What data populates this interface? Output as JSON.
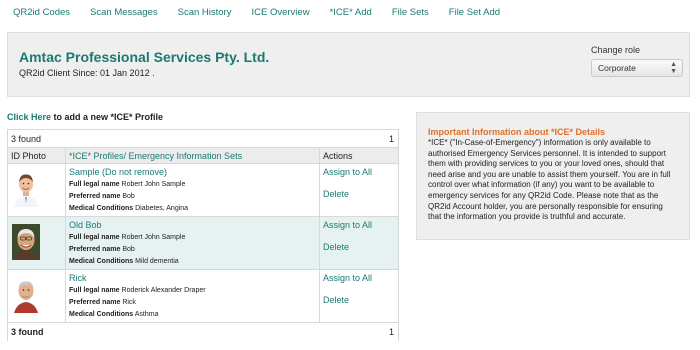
{
  "nav": {
    "items": [
      "QR2id Codes",
      "Scan Messages",
      "Scan History",
      "ICE Overview",
      "*ICE* Add",
      "File Sets",
      "File Set Add"
    ]
  },
  "header": {
    "company": "Amtac Professional Services Pty. Ltd.",
    "client_since": "QR2id Client Since: 01 Jan 2012 .",
    "role_label": "Change role",
    "role_value": "Corporate"
  },
  "add_profile": {
    "link": "Click Here",
    "text": " to add a new *ICE* Profile"
  },
  "table": {
    "count_top": "3 found",
    "page_top": "1",
    "columns": [
      "ID Photo",
      "*ICE* Profiles/ Emergency Information Sets",
      "Actions"
    ],
    "labels": {
      "legal": "Full legal name",
      "preferred": "Preferred name",
      "medical": "Medical Conditions"
    },
    "rows": [
      {
        "name": "Sample (Do not remove)",
        "legal": "Robert John Sample",
        "preferred": "Bob",
        "medical": "Diabetes, Angina",
        "assign": "Assign to All",
        "delete": "Delete"
      },
      {
        "name": "Old Bob",
        "legal": "Robert John Sample",
        "preferred": "Bob",
        "medical": "Mild dementia",
        "assign": "Assign to All",
        "delete": "Delete"
      },
      {
        "name": "Rick",
        "legal": "Roderick Alexander Draper",
        "preferred": "Rick",
        "medical": "Asthma",
        "assign": "Assign to All",
        "delete": "Delete"
      }
    ],
    "count_bottom": "3 found",
    "page_bottom": "1"
  },
  "info": {
    "title": "Important Information about *ICE* Details",
    "body": "*ICE* (\"In-Case-of-Emergency\") information is only available to authorised Emergency Services personnel. It is intended to support them with providing services to you or your loved ones, should that need arise and you are unable to assist them yourself. You are in full control over what information (if any) you want to be available to emergency services for any QR2id Code. Please note that as the QR2id Account holder, you are personally responsible for ensuring that the information you provide is truthful and accurate."
  },
  "colors": {
    "link": "#1a7a72",
    "info_title": "#e0712a",
    "alt_row": "#e6f2f1",
    "panel": "#efefef"
  }
}
